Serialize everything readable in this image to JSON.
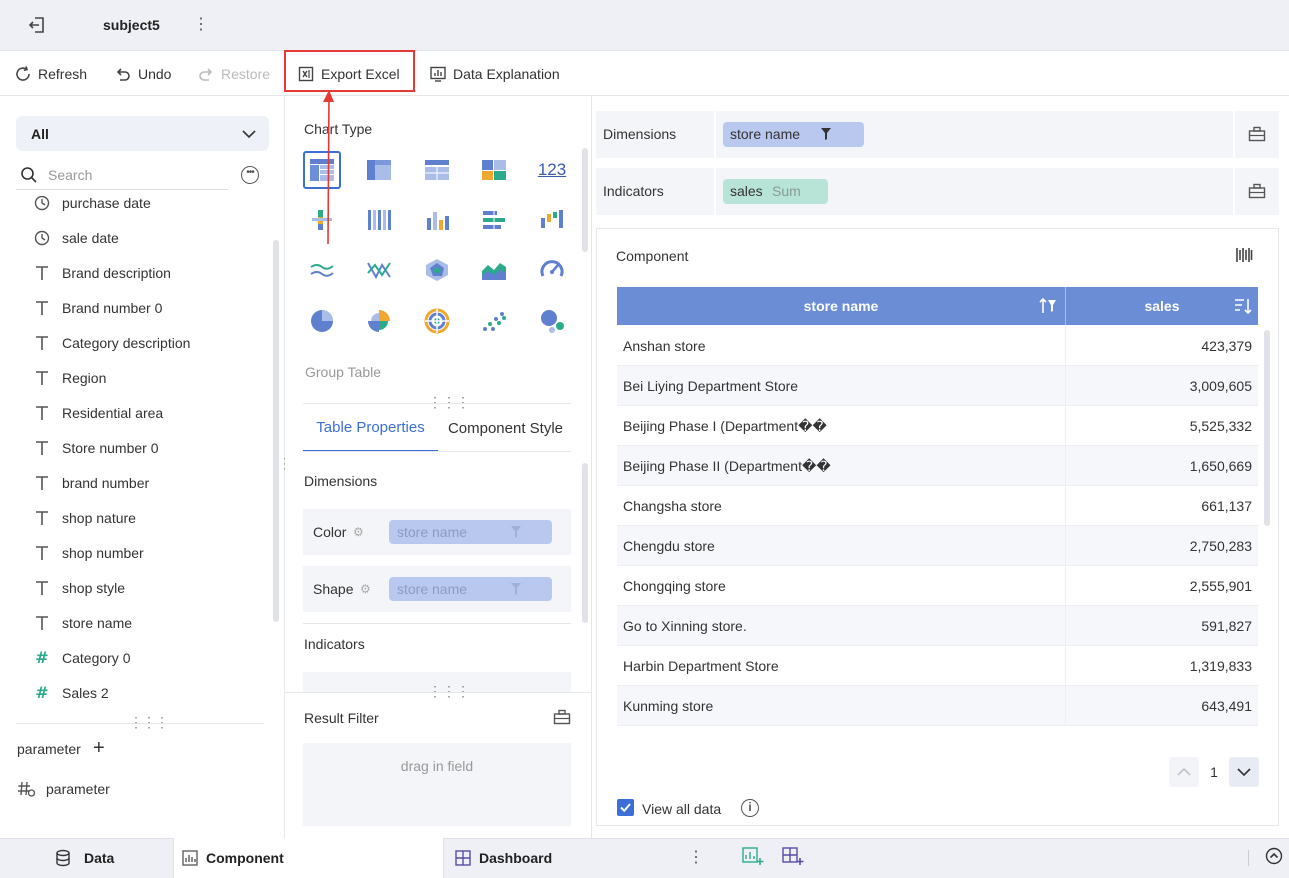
{
  "header": {
    "title": "subject5",
    "back_icon": "exit-icon",
    "more_icon": "vertical-dots-icon"
  },
  "toolbar": {
    "refresh": "Refresh",
    "undo": "Undo",
    "restore": "Restore",
    "export_excel": "Export Excel",
    "data_explanation": "Data Explanation"
  },
  "left_panel": {
    "group_select": "All",
    "search_placeholder": "Search",
    "fields": [
      {
        "label": "purchase date",
        "type": "date"
      },
      {
        "label": "sale date",
        "type": "date"
      },
      {
        "label": "Brand description",
        "type": "text"
      },
      {
        "label": "Brand number 0",
        "type": "text"
      },
      {
        "label": "Category description",
        "type": "text"
      },
      {
        "label": "Region",
        "type": "text"
      },
      {
        "label": "Residential area",
        "type": "text"
      },
      {
        "label": "Store number 0",
        "type": "text"
      },
      {
        "label": "brand number",
        "type": "text"
      },
      {
        "label": "shop nature",
        "type": "text"
      },
      {
        "label": "shop number",
        "type": "text"
      },
      {
        "label": "shop style",
        "type": "text"
      },
      {
        "label": "store name",
        "type": "text"
      },
      {
        "label": "Category 0",
        "type": "measure"
      },
      {
        "label": "Sales 2",
        "type": "measure"
      }
    ],
    "parameter_header": "parameter",
    "parameter_item": "parameter"
  },
  "middle_panel": {
    "chart_type_title": "Chart Type",
    "chart_type_number_label": "123",
    "selected_chart_name": "Group Table",
    "tabs": {
      "table_properties": "Table Properties",
      "component_style": "Component Style"
    },
    "dimensions_label": "Dimensions",
    "color_label": "Color",
    "color_field": "store name",
    "shape_label": "Shape",
    "shape_field": "store name",
    "indicators_label": "Indicators",
    "result_filter_label": "Result Filter",
    "result_filter_placeholder": "drag in field"
  },
  "shelves": {
    "dimensions_label": "Dimensions",
    "dimensions_field": "store name",
    "indicators_label": "Indicators",
    "indicators_field": "sales",
    "indicators_agg": "Sum"
  },
  "component": {
    "title": "Component",
    "columns": [
      "store name",
      "sales"
    ],
    "rows": [
      {
        "name": "Anshan store",
        "value": "423,379"
      },
      {
        "name": "Bei Liying Department Store",
        "value": "3,009,605"
      },
      {
        "name": "Beijing Phase I (Department��",
        "value": "5,525,332"
      },
      {
        "name": "Beijing Phase II (Department��",
        "value": "1,650,669"
      },
      {
        "name": "Changsha store",
        "value": "661,137"
      },
      {
        "name": "Chengdu store",
        "value": "2,750,283"
      },
      {
        "name": "Chongqing store",
        "value": "2,555,901"
      },
      {
        "name": "Go to Xinning store.",
        "value": "591,827"
      },
      {
        "name": "Harbin Department Store",
        "value": "1,319,833"
      },
      {
        "name": "Kunming store",
        "value": "643,491"
      }
    ],
    "page": "1",
    "view_all_label": "View all data",
    "view_all_checked": true
  },
  "bottom_tabs": {
    "data": "Data",
    "component": "Component",
    "dashboard": "Dashboard"
  },
  "colors": {
    "accent": "#3b6fd6",
    "header_blue": "#6b8dd6",
    "measure_green": "#2bab8c",
    "highlight_red": "#e53935"
  }
}
